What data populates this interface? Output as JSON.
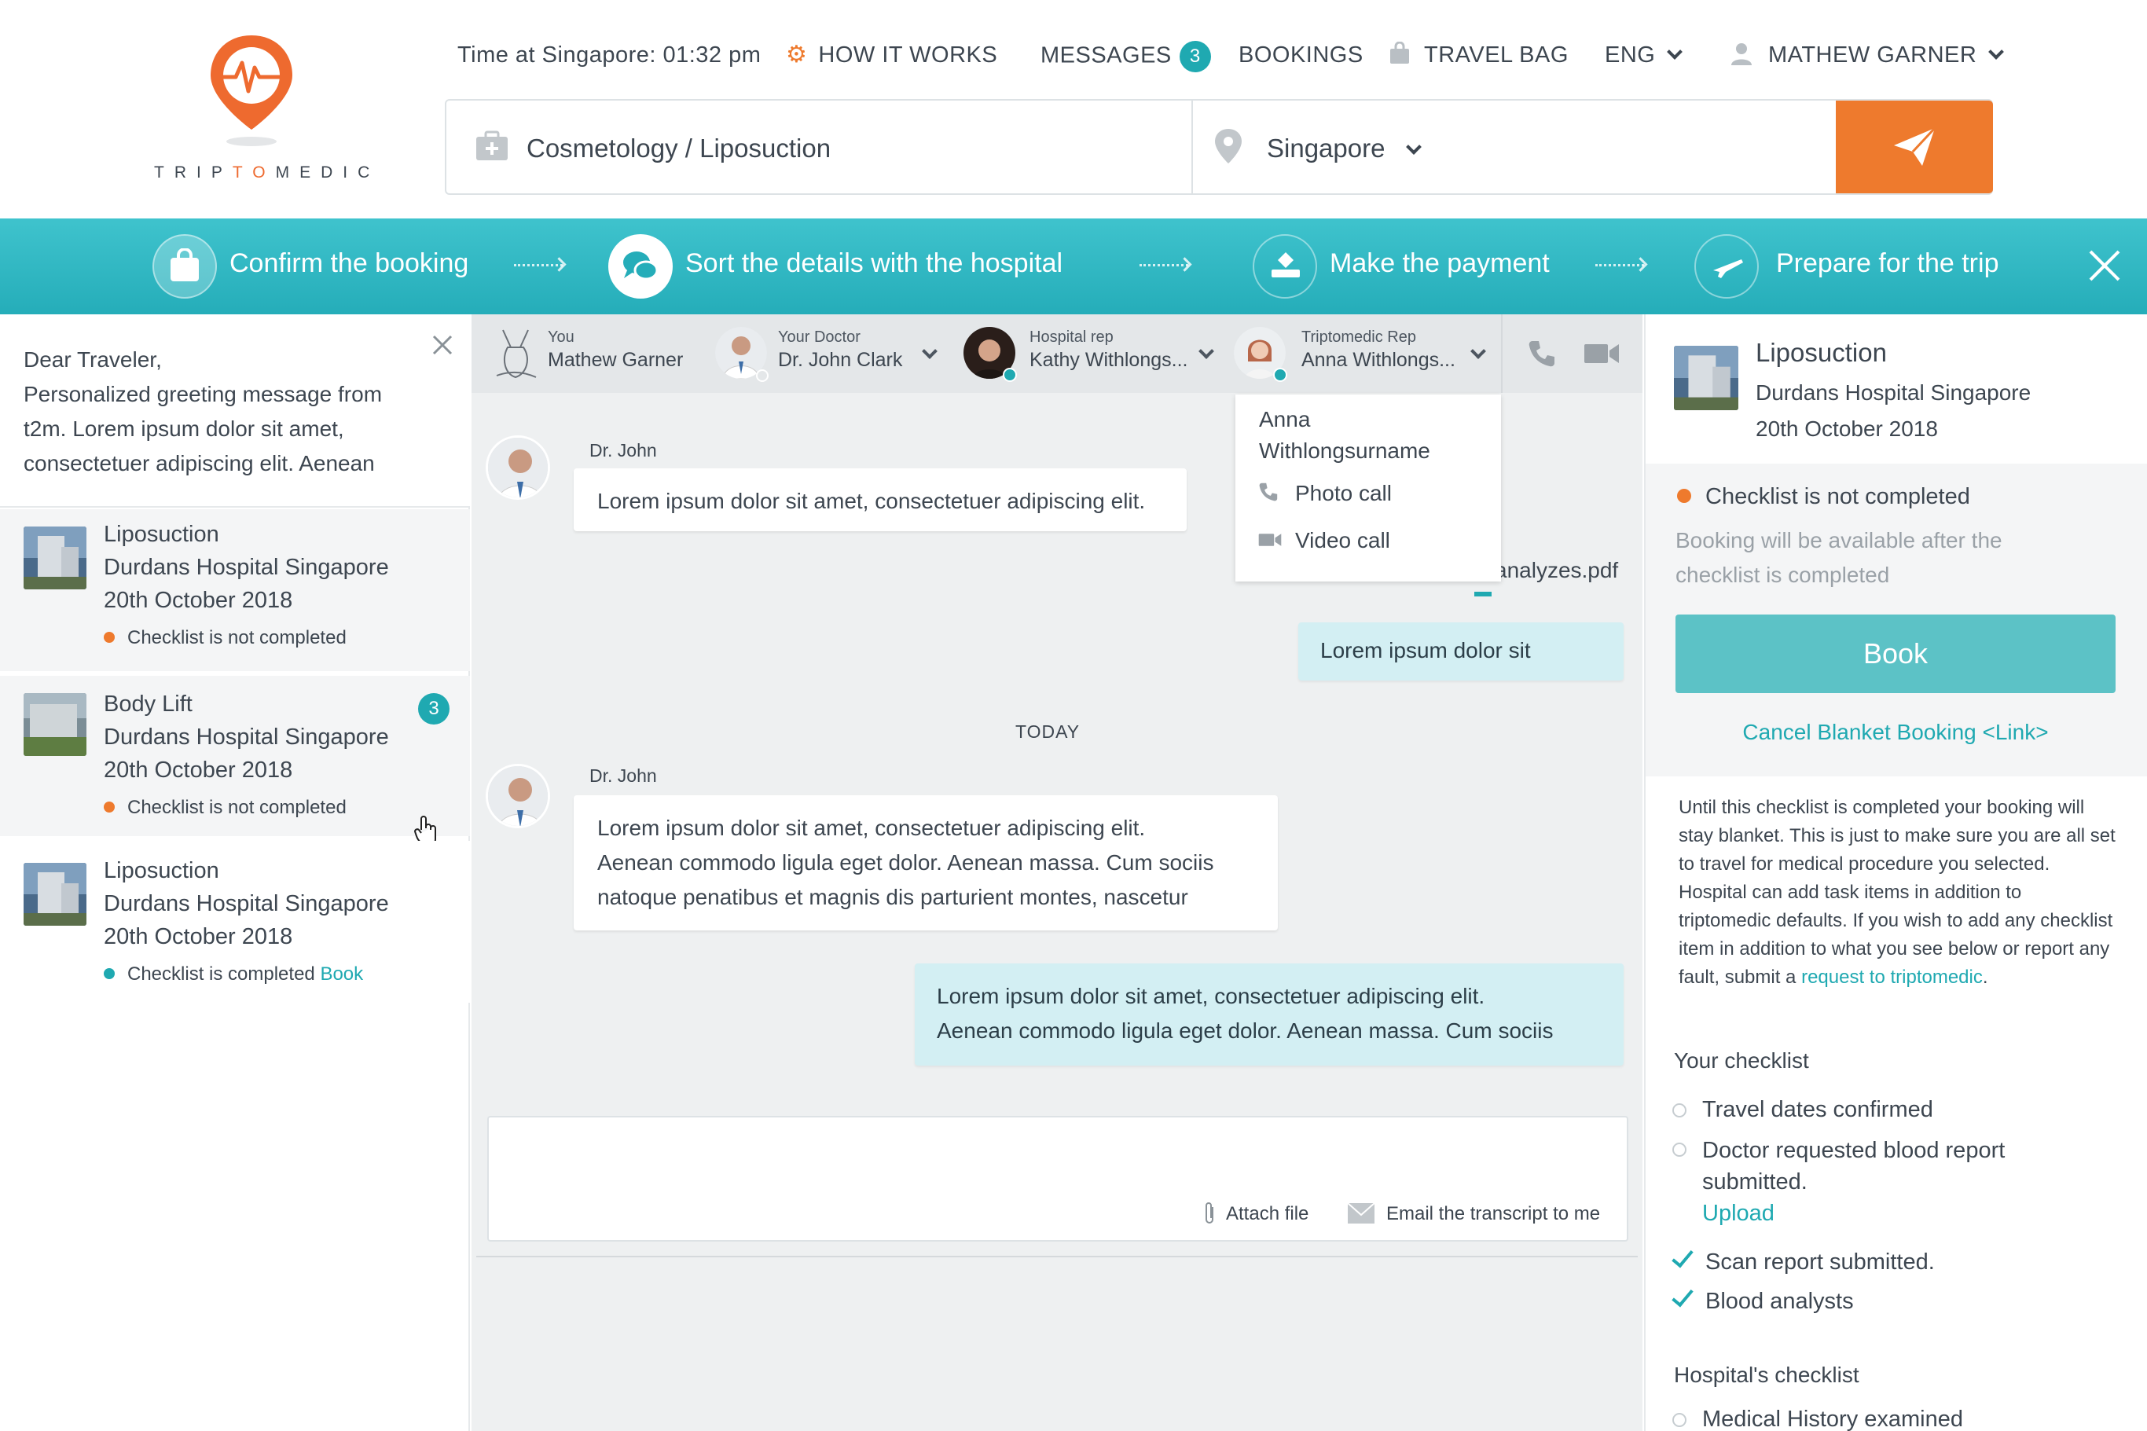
{
  "brand": {
    "name": "TRIPTOMEDIC",
    "name_pre": "TRIP",
    "name_mid": "TO",
    "name_post": "MEDIC"
  },
  "header": {
    "time": "Time at Singapore: 01:32 pm",
    "how_it_works": "HOW IT WORKS",
    "messages": "MESSAGES",
    "messages_count": "3",
    "bookings": "BOOKINGS",
    "travel_bag": "TRAVEL BAG",
    "language": "ENG",
    "user": "MATHEW GARNER"
  },
  "search": {
    "treatment": "Cosmetology / Liposuction",
    "location": "Singapore"
  },
  "steps": [
    {
      "label": "Confirm the booking"
    },
    {
      "label": "Sort the details with the hospital"
    },
    {
      "label": "Make the payment"
    },
    {
      "label": "Prepare for the trip"
    }
  ],
  "greeting": {
    "line1": "Dear Traveler,",
    "line2": "Personalized greeting message from",
    "line3": "t2m. Lorem ipsum dolor sit amet,",
    "line4": "consectetuer adipiscing elit. Aenean"
  },
  "bookings": [
    {
      "procedure": "Liposuction",
      "hospital": "Durdans Hospital Singapore",
      "date": "20th October 2018",
      "status": "Checklist is not completed",
      "status_color": "#ee7a2d"
    },
    {
      "procedure": "Body Lift",
      "hospital": "Durdans Hospital Singapore",
      "date": "20th October 2018",
      "status": "Checklist is not completed",
      "status_color": "#ee7a2d",
      "badge": "3"
    },
    {
      "procedure": "Liposuction",
      "hospital": "Durdans Hospital Singapore",
      "date": "20th October 2018",
      "status": "Checklist is completed",
      "status_color": "#1fa9b1",
      "action": "Book"
    }
  ],
  "participants": [
    {
      "role": "You",
      "name": "Mathew Garner"
    },
    {
      "role": "Your Doctor",
      "name": "Dr. John Clark"
    },
    {
      "role": "Hospital rep",
      "name": "Kathy Withlongs..."
    },
    {
      "role": "Triptomedic Rep",
      "name": "Anna Withlongs..."
    }
  ],
  "dropdown": {
    "name_line1": "Anna",
    "name_line2": "Withlongsurname",
    "photo_call": "Photo call",
    "video_call": "Video call"
  },
  "messages": {
    "m1_sender": "Dr. John",
    "m1_text": "Lorem ipsum dolor sit amet, consectetuer adipiscing elit.",
    "attachment": "analyzes.pdf",
    "m2_text": "Lorem ipsum dolor sit",
    "day_divider": "TODAY",
    "m3_sender": "Dr. John",
    "m3_line1": "Lorem ipsum dolor sit amet, consectetuer adipiscing elit.",
    "m3_line2": "Aenean commodo ligula eget dolor. Aenean massa. Cum sociis",
    "m3_line3": "natoque penatibus et magnis dis parturient montes, nascetur",
    "m4_line1": "Lorem ipsum dolor sit amet, consectetuer adipiscing elit.",
    "m4_line2": "Aenean commodo ligula eget dolor. Aenean massa. Cum sociis"
  },
  "composer": {
    "attach": "Attach file",
    "email": "Email the transcript to me"
  },
  "right": {
    "procedure": "Liposuction",
    "hospital": "Durdans Hospital Singapore",
    "date": "20th October 2018",
    "status": "Checklist is not completed",
    "note_line1": "Booking will be available after the",
    "note_line2": "checklist is completed",
    "book": "Book",
    "cancel": "Cancel Blanket Booking <Link>",
    "info_text": "Until this checklist is completed your booking will stay blanket. This is just to make sure you are all set to travel for medical procedure you selected. Hospital can add task items in addition to triptomedic defaults. If you wish to add any checklist item in addition to what you see below or report any fault, submit a ",
    "info_link": "request to triptomedic",
    "info_end": ".",
    "your_checklist": "Your checklist",
    "items": [
      {
        "label": "Travel dates confirmed",
        "done": false
      },
      {
        "label": "Doctor requested blood report",
        "label2": "submitted.",
        "action": "Upload",
        "done": false
      },
      {
        "label": "Scan report submitted.",
        "done": true
      },
      {
        "label": "Blood analysts",
        "done": true
      }
    ],
    "hospital_checklist": "Hospital's checklist",
    "hospital_items": [
      {
        "label": "Medical History examined",
        "done": false
      }
    ]
  },
  "colors": {
    "accent": "#1fa9b1",
    "brand_orange": "#ee7a2d",
    "steps_bar": "#2fb8c3"
  }
}
